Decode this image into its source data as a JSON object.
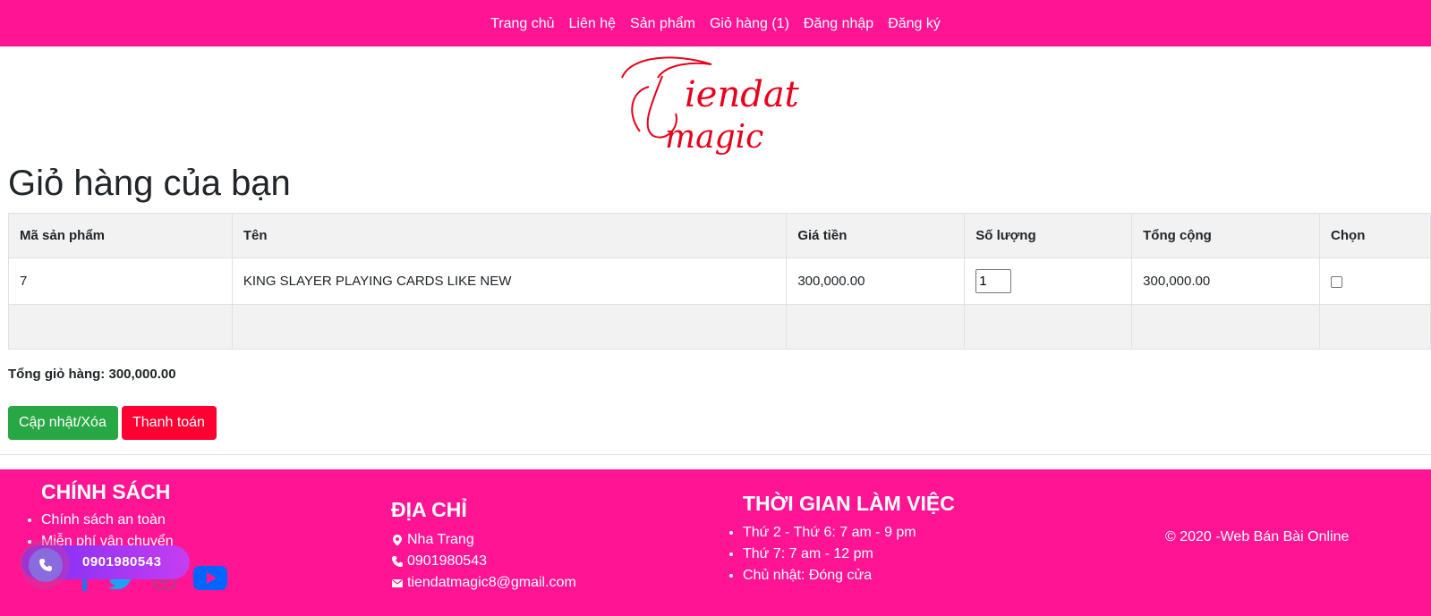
{
  "nav": {
    "items": [
      "Trang chủ",
      "Liên hệ",
      "Sản phẩm",
      "Giỏ hàng (1)",
      "Đăng nhập",
      "Đăng ký"
    ]
  },
  "logo": {
    "line1": "Tiendat",
    "line2": "magic",
    "color": "#e8001c"
  },
  "page": {
    "title": "Giỏ hàng của bạn"
  },
  "table": {
    "headers": [
      "Mã sản phẩm",
      "Tên",
      "Giá tiền",
      "Số lượng",
      "Tổng cộng",
      "Chọn"
    ],
    "rows": [
      {
        "id": "7",
        "name": "KING SLAYER PLAYING CARDS LIKE NEW",
        "price": "300,000.00",
        "qty": "1",
        "total": "300,000.00",
        "selected": false
      }
    ]
  },
  "cart": {
    "total_label": "Tổng giỏ hàng: 300,000.00",
    "update_label": "Cập nhật/Xóa",
    "checkout_label": "Thanh toán"
  },
  "footer": {
    "policy_title": "CHÍNH SÁCH",
    "policy_items": [
      "Chính sách an toàn",
      "Miễn phí vận chuyển"
    ],
    "address_title": "ĐỊA CHỈ",
    "address_city": "Nha Trang",
    "address_phone": "0901980543",
    "address_email": "tiendatmagic8@gmail.com",
    "hours_title": "THỜI GIAN LÀM VIỆC",
    "hours_items": [
      "Thứ 2 - Thứ 6: 7 am - 9 pm",
      "Thứ 7: 7 am - 12 pm",
      "Chủ nhật: Đóng cửa"
    ],
    "copyright": "© 2020 -Web Bán Bài Online"
  },
  "phone_widget": {
    "number": "0901980543"
  },
  "colors": {
    "brand_pink": "#ff1493",
    "success": "#28a745",
    "danger": "#ff0033"
  }
}
